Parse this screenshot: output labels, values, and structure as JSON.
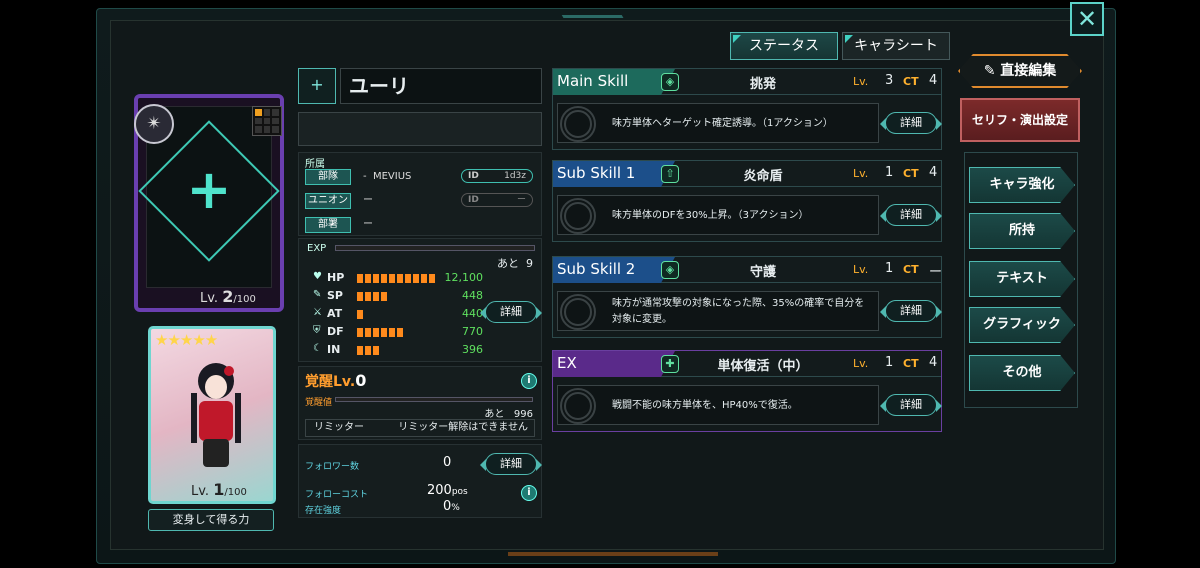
{
  "tabs": {
    "status": "ステータス",
    "chara_sheet": "キャラシート"
  },
  "character": {
    "name": "ユーリ",
    "level": "2",
    "level_max": "/100",
    "level_prefix": "Lv.",
    "card_level": "1",
    "card_level_max": "/100",
    "transform_label": "変身して得る力"
  },
  "affiliation": {
    "header": "所属",
    "rows": [
      {
        "tag": "部隊",
        "value": "MEVIUS",
        "id_label": "ID",
        "id_value": "1d3z"
      },
      {
        "tag": "ユニオン",
        "value": "ー",
        "id_label": "ID",
        "id_value": "ー"
      },
      {
        "tag": "部署",
        "value": "ー"
      }
    ]
  },
  "stats": {
    "exp_label": "EXP",
    "exp_remaining_label": "あと",
    "exp_remaining": "9",
    "items": [
      {
        "name": "HP",
        "value": "12,100",
        "bars": 10,
        "icon": "heart-icon"
      },
      {
        "name": "SP",
        "value": "448",
        "bars": 4,
        "icon": "sp-icon"
      },
      {
        "name": "AT",
        "value": "440",
        "bars": 1,
        "icon": "sword-icon"
      },
      {
        "name": "DF",
        "value": "770",
        "bars": 6,
        "icon": "shield-icon"
      },
      {
        "name": "IN",
        "value": "396",
        "bars": 3,
        "icon": "moon-icon"
      }
    ],
    "detail_label": "詳細"
  },
  "awakening": {
    "title": "覚醒Lv.",
    "level": "0",
    "value_label": "覚醒値",
    "remaining_label": "あと",
    "remaining": "996",
    "limiter_label": "リミッター",
    "limiter_value": "リミッター解除はできません"
  },
  "follow": {
    "followers_label": "フォロワー数",
    "followers": "0",
    "cost_label": "フォローコスト",
    "cost": "200",
    "cost_unit": "pos",
    "existence_label": "存在強度",
    "existence": "0",
    "existence_unit": "%",
    "detail_label": "詳細"
  },
  "skills": [
    {
      "type": "Main Skill",
      "name": "挑発",
      "lv_label": "Lv.",
      "lv": "3",
      "ct_label": "CT",
      "ct": "4",
      "desc": "味方単体ヘターゲット確定誘導。（1アクション）",
      "color": "#1d6a5c",
      "detail": "詳細"
    },
    {
      "type": "Sub Skill 1",
      "name": "炎命盾",
      "lv_label": "Lv.",
      "lv": "1",
      "ct_label": "CT",
      "ct": "4",
      "desc": "味方単体のDFを30%上昇。（3アクション）",
      "color": "#1c4f8a",
      "detail": "詳細"
    },
    {
      "type": "Sub Skill 2",
      "name": "守護",
      "lv_label": "Lv.",
      "lv": "1",
      "ct_label": "CT",
      "ct": "ー",
      "desc": "味方が通常攻撃の対象になった際、35%の確率で自分を対象に変更。",
      "color": "#1c4f8a",
      "detail": "詳細"
    },
    {
      "type": "EX",
      "name": "単体復活（中）",
      "lv_label": "Lv.",
      "lv": "1",
      "ct_label": "CT",
      "ct": "4",
      "desc": "戦闘不能の味方単体を、HP40%で復活。",
      "color": "#5a2a8a",
      "detail": "詳細"
    }
  ],
  "right_menu": {
    "edit": "直接編集",
    "serif": "セリフ・演出設定",
    "buttons": [
      "キャラ強化",
      "所持",
      "テキスト",
      "グラフィック",
      "その他"
    ]
  },
  "colors": {
    "accent": "#4fb8b0",
    "orange": "#ff9d2e",
    "value_green": "#5fe05f"
  }
}
